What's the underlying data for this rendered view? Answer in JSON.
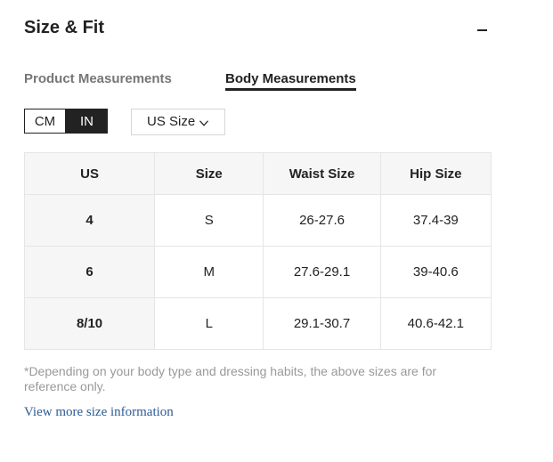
{
  "section": {
    "title": "Size & Fit",
    "collapse_icon": "minus-icon"
  },
  "tabs": [
    {
      "label": "Product Measurements",
      "active": false
    },
    {
      "label": "Body Measurements",
      "active": true
    }
  ],
  "units": {
    "options": [
      "CM",
      "IN"
    ],
    "selected": "IN"
  },
  "size_system": {
    "selected": "US Size",
    "icon": "chevron-down-icon"
  },
  "table": {
    "headers": [
      "US",
      "Size",
      "Waist Size",
      "Hip Size"
    ],
    "rows": [
      [
        "4",
        "S",
        "26-27.6",
        "37.4-39"
      ],
      [
        "6",
        "M",
        "27.6-29.1",
        "39-40.6"
      ],
      [
        "8/10",
        "L",
        "29.1-30.7",
        "40.6-42.1"
      ]
    ]
  },
  "note": "*Depending on your body type and dressing habits, the above sizes are for reference only.",
  "more_link": "View more size information",
  "colors": {
    "text": "#222222",
    "muted": "#767676",
    "note": "#999999",
    "link": "#2d5a96",
    "header_bg": "#f6f6f6",
    "border": "#e5e5e5"
  }
}
